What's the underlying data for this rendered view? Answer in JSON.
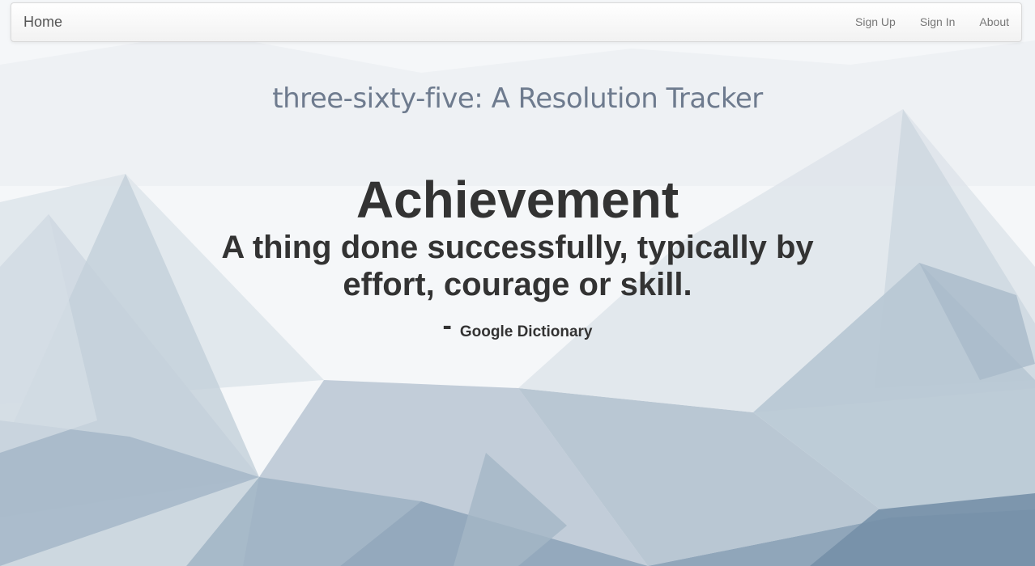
{
  "navbar": {
    "brand": "Home",
    "links": [
      "Sign Up",
      "Sign In",
      "About"
    ]
  },
  "hero": {
    "title": "three-sixty-five: A Resolution Tracker",
    "word": "Achievement",
    "definition": "A thing done successfully, typically by effort, courage or skill.",
    "source_dash": "-",
    "source": "Google Dictionary"
  },
  "colors": {
    "title": "#6e7b8e",
    "text": "#333333",
    "background_light": "#f4f6f8",
    "background_mountain": "#8ea3b7"
  }
}
